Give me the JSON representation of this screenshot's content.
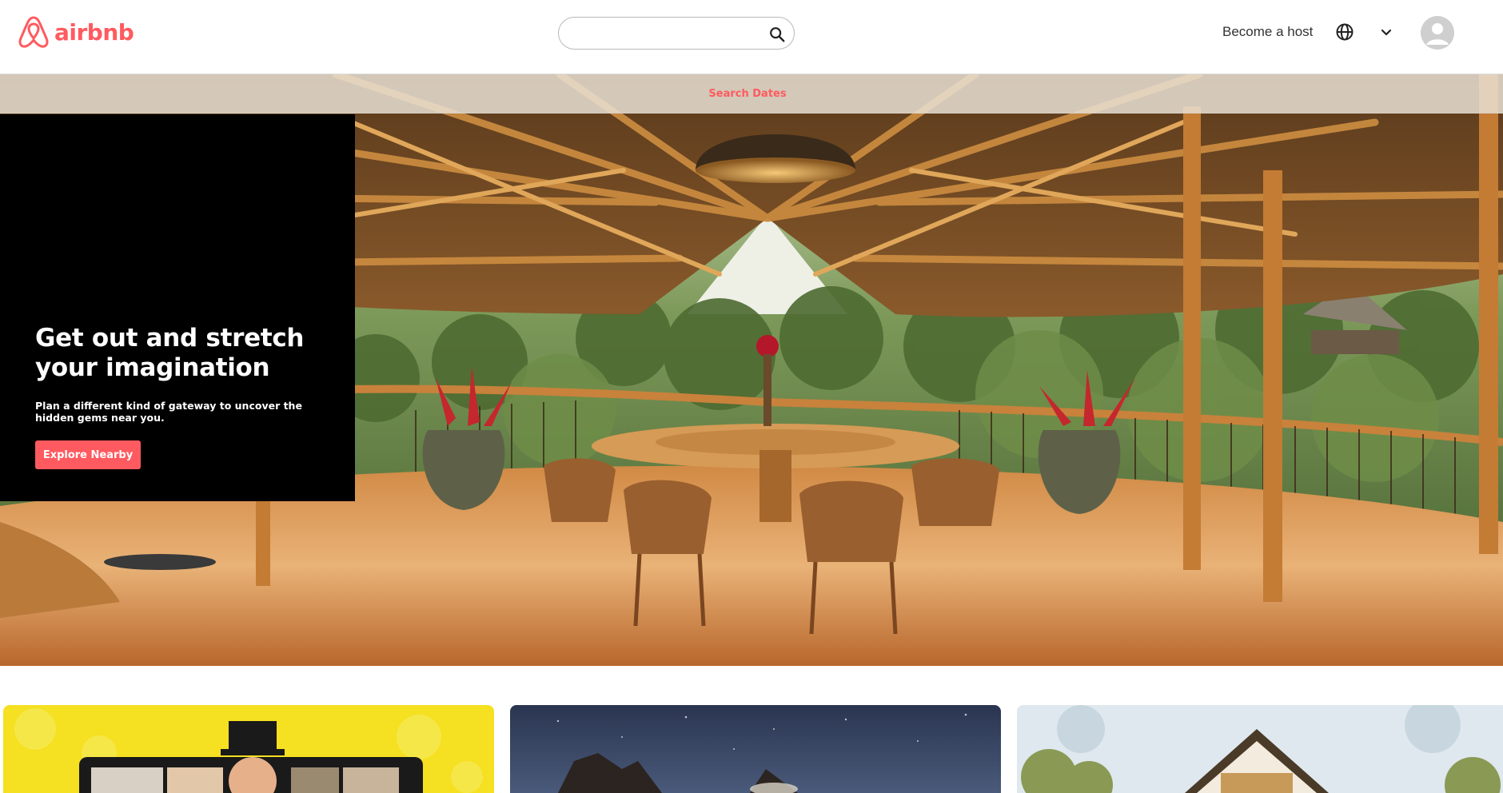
{
  "header": {
    "brand": "airbnb",
    "search_placeholder": "",
    "become_host": "Become a host",
    "icons": [
      "airbnb-logo-icon",
      "search-icon",
      "globe-icon",
      "chevron-down-icon",
      "user-avatar-icon"
    ]
  },
  "strip": {
    "link": "Search Dates"
  },
  "hero": {
    "title": "Get out and stretch your imagination",
    "subtitle": "Plan a different kind of gateway to uncover the hidden gems near you.",
    "button": "Explore Nearby"
  },
  "colors": {
    "brand": "#ff5a5f",
    "promo_bg": "#000000"
  }
}
